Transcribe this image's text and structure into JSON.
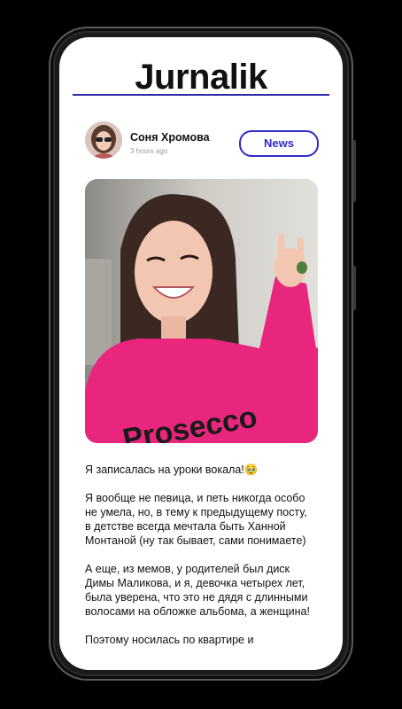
{
  "app": {
    "logo_text": "Jurnalik"
  },
  "post": {
    "author_name": "Соня Хромова",
    "time": "3 hours ago",
    "category_button": "News",
    "paragraphs": [
      "Я записалась на уроки вокала!🥹",
      "Я вообще не певица, и петь никогда особо не умела, но, в тему к предыдущему посту, в детстве всегда мечтала быть Ханной Монтаной (ну так бывает, сами понимаете)",
      "А еще, из мемов, у родителей был диск Димы Маликова, и я, девочка четырех лет, была уверена, что это не дядя с длинными волосами на обложке альбома, а женщина!",
      "Поэтому носилась по квартире и"
    ],
    "photo_sweater_text": "Prosecco"
  },
  "colors": {
    "accent": "#3129c9",
    "sweater": "#e8267d"
  }
}
